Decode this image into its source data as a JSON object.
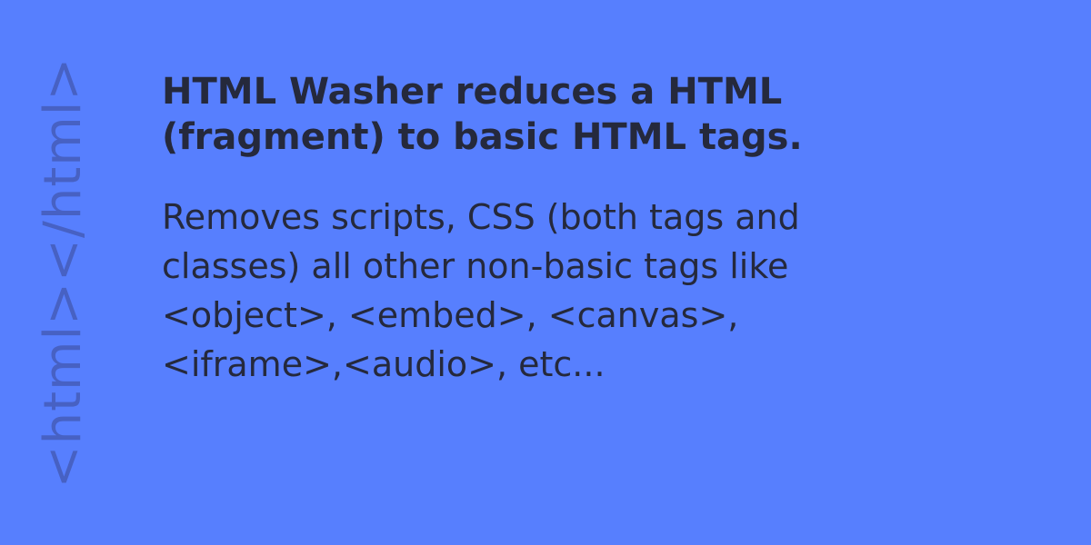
{
  "colors": {
    "background": "#577ffe",
    "logo_text": "#4761c3",
    "body_text": "#25293c"
  },
  "side_logo": {
    "text": "<html></html>"
  },
  "headline": {
    "line1": "HTML Washer reduces a HTML",
    "line2": "(fragment) to basic HTML tags."
  },
  "description": {
    "line1": "Removes scripts, CSS (both tags and",
    "line2": "classes) all other non-basic tags like",
    "line3": "<object>, <embed>, <canvas>,",
    "line4": "<iframe>,<audio>, etc..."
  }
}
